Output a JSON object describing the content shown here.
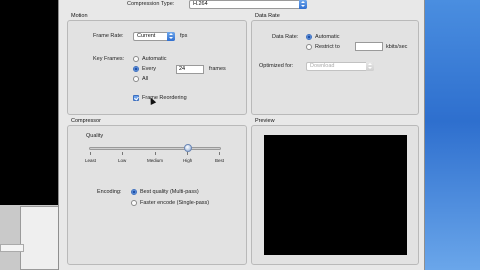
{
  "compression": {
    "label": "Compression Type:",
    "value": "H.264"
  },
  "motion": {
    "title": "Motion",
    "frame_rate_label": "Frame Rate:",
    "frame_rate_value": "Current",
    "frame_rate_unit": "fps",
    "key_frames_label": "Key Frames:",
    "key_frames_options": [
      "Automatic",
      "Every",
      "All"
    ],
    "key_frames_selected": "Every",
    "key_frames_every_value": "24",
    "key_frames_every_unit": "frames",
    "frame_reordering_label": "Frame Reordering",
    "frame_reordering_checked": true
  },
  "data_rate": {
    "title": "Data Rate",
    "label": "Data Rate:",
    "options": [
      "Automatic",
      "Restrict to"
    ],
    "selected": "Automatic",
    "restrict_value": "",
    "unit": "kbits/sec",
    "optimized_label": "Optimized for:",
    "optimized_value": "Download"
  },
  "compressor": {
    "title": "Compressor",
    "quality_label": "Quality",
    "quality_ticks": [
      "Least",
      "Low",
      "Medium",
      "High",
      "Best"
    ],
    "quality_value": "High",
    "encoding_label": "Encoding:",
    "encoding_options": [
      "Best quality (Multi-pass)",
      "Faster encode (Single-pass)"
    ],
    "encoding_selected": "Best quality (Multi-pass)"
  },
  "preview": {
    "title": "Preview"
  },
  "colors": {
    "accent": "#3d6fbf",
    "dialog_bg": "#e8e8e8",
    "desktop": "#2e6fce"
  }
}
